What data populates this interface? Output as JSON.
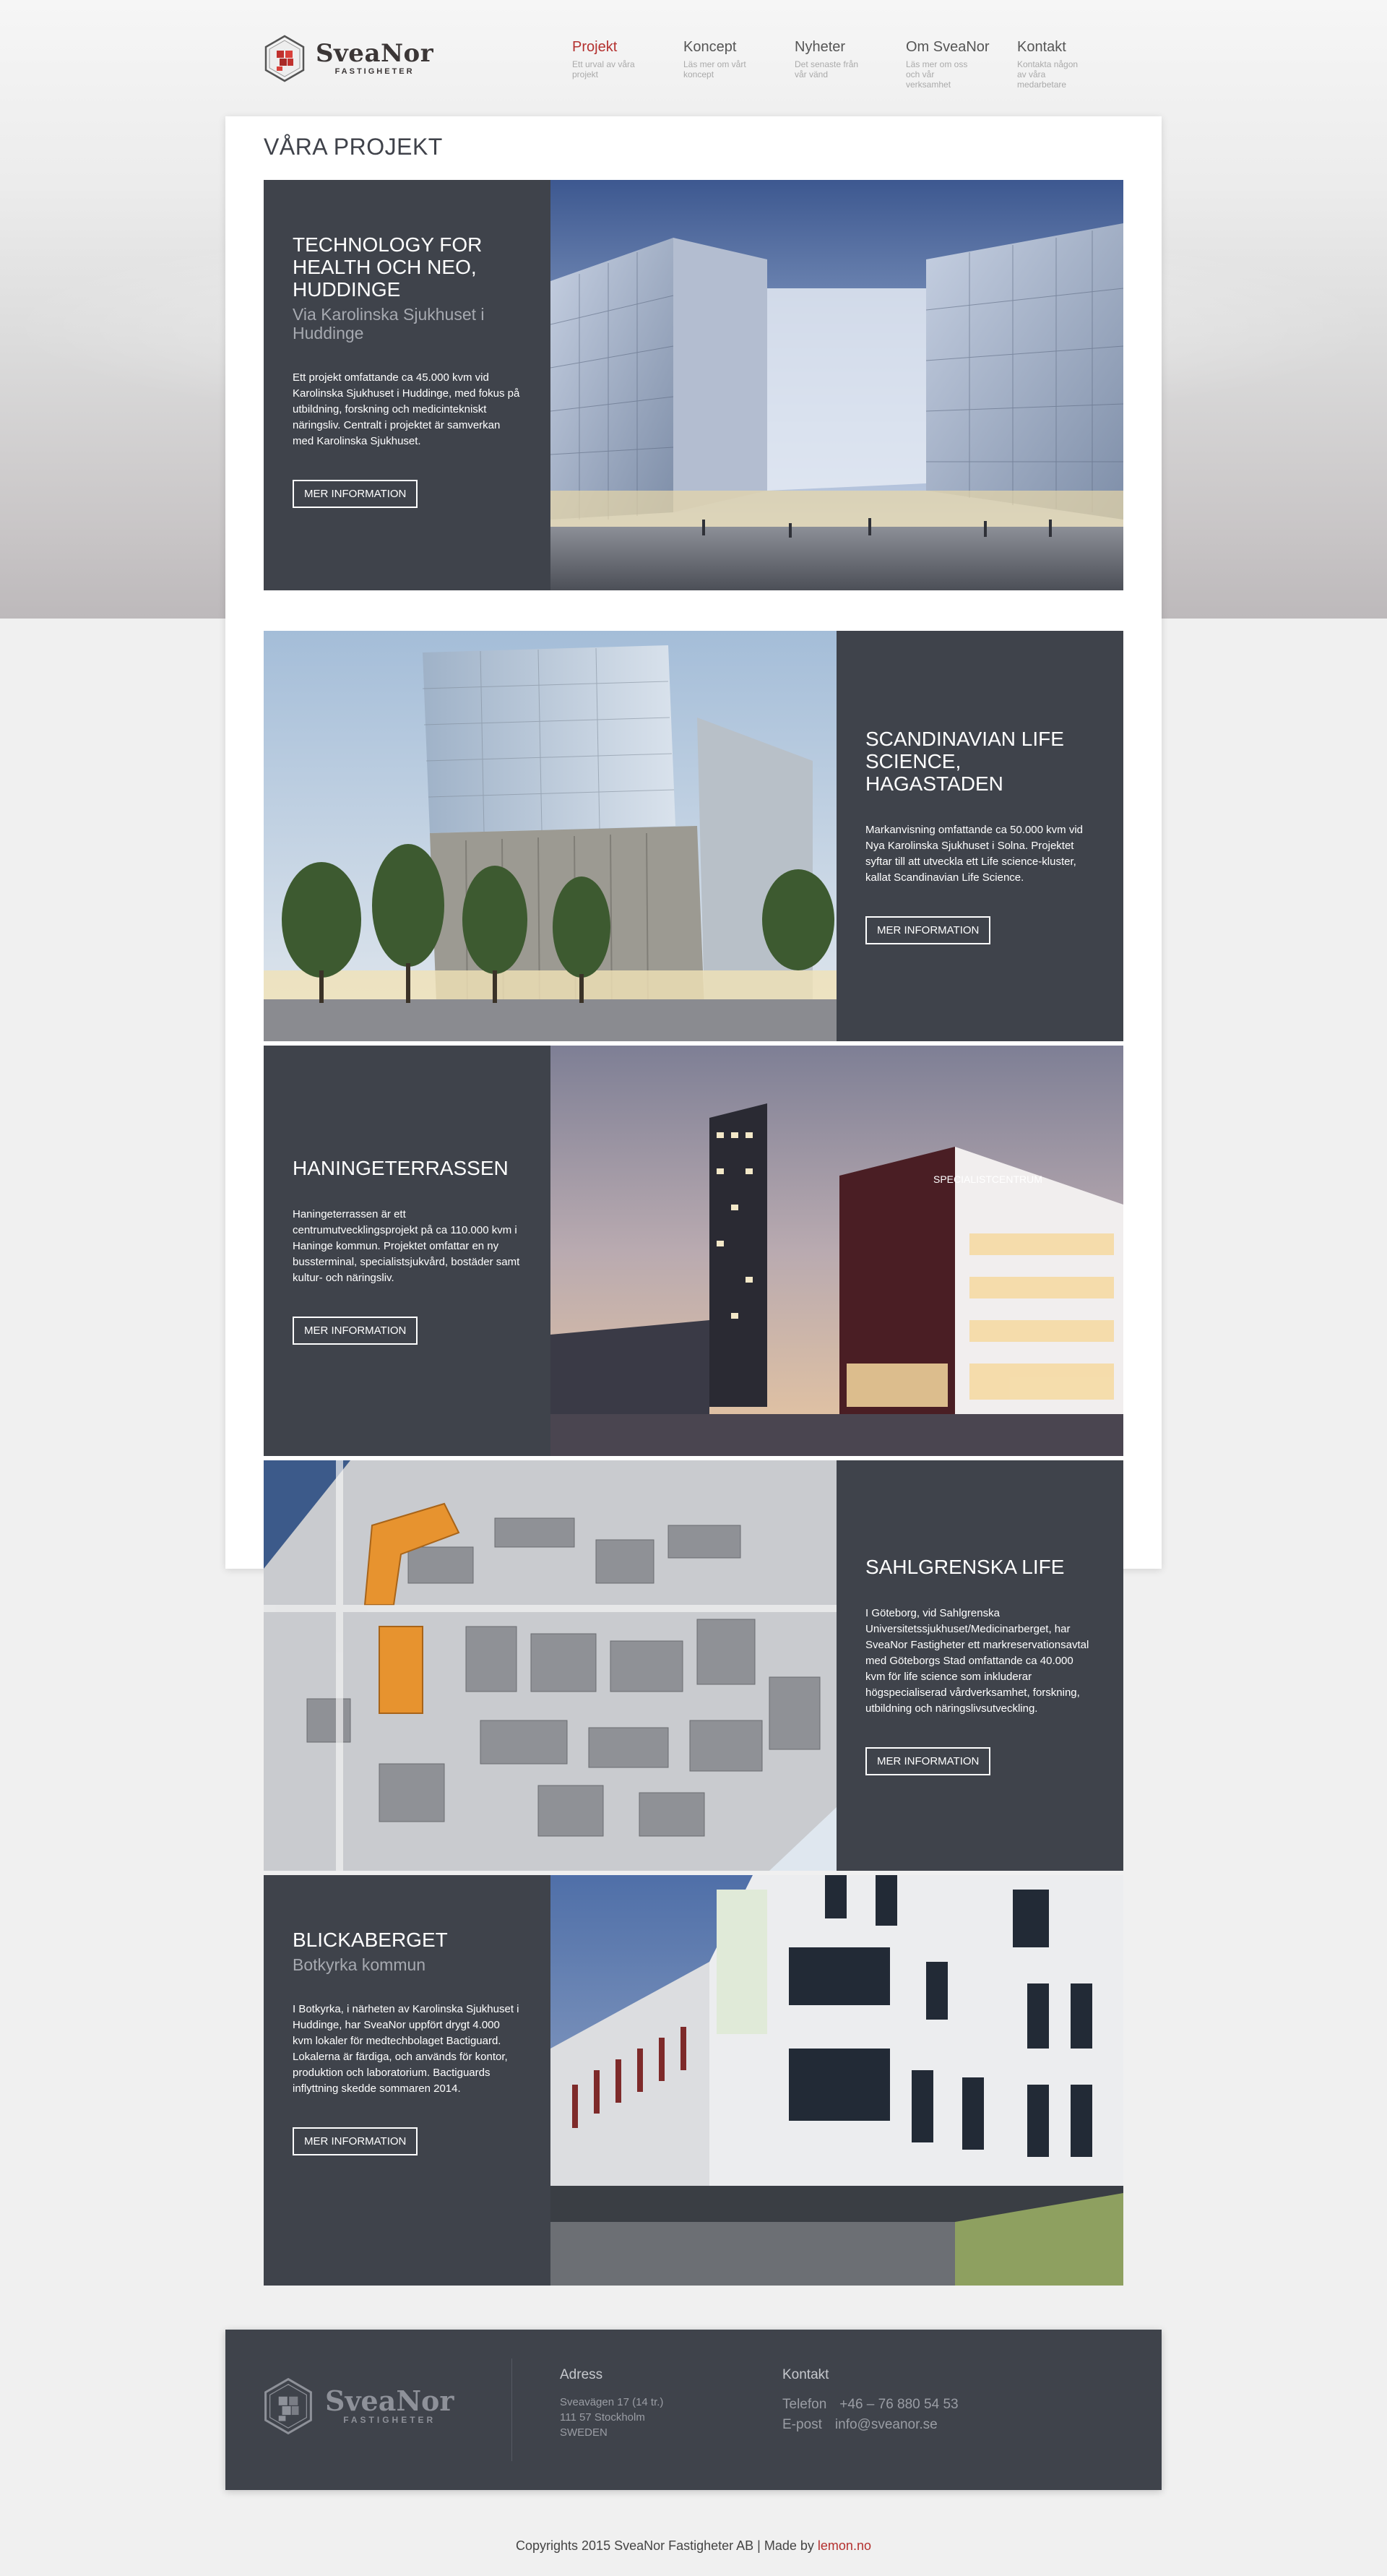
{
  "brand": {
    "name": "SveaNor",
    "sub": "FASTIGHETER",
    "accent": "#b4312f",
    "dark_panel": "#3f434b"
  },
  "nav": [
    {
      "title": "Projekt",
      "desc": "Ett urval av våra projekt",
      "active": true
    },
    {
      "title": "Koncept",
      "desc": "Läs mer om vårt koncept",
      "active": false
    },
    {
      "title": "Nyheter",
      "desc": "Det senaste från vår vänd",
      "active": false
    },
    {
      "title": "Om SveaNor",
      "desc": "Läs mer om oss och vår verksamhet",
      "active": false
    },
    {
      "title": "Kontakt",
      "desc": "Kontakta någon av våra medarbetare",
      "active": false
    }
  ],
  "page_title": "VÅRA PROJEKT",
  "projects": [
    {
      "title": "TECHNOLOGY FOR HEALTH OCH NEO, HUDDINGE",
      "subtitle": "Via Karolinska Sjukhuset i Huddinge",
      "desc": "Ett projekt omfattande ca 45.000 kvm vid Karolinska Sjukhuset i Huddinge, med fokus på utbildning, forskning och medicintekniskt näringsliv. Centralt i projektet är samverkan med Karolinska Sjukhuset.",
      "button": "MER INFORMATION",
      "image": "glass-building-illustration"
    },
    {
      "title": "SCANDINAVIAN LIFE SCIENCE, HAGASTADEN",
      "desc": "Markanvisning omfattande ca 50.000 kvm vid Nya Karolinska Sjukhuset i Solna. Projektet syftar till att utveckla ett Life science-kluster, kallat Scandinavian Life Science.",
      "button": "MER INFORMATION",
      "image": "tower-with-trees-illustration"
    },
    {
      "title": "HANINGETERRASSEN",
      "desc": "Haningeterrassen är ett centrumutvecklingsprojekt på ca 110.000 kvm i Haninge kommun. Projektet omfattar en ny bussterminal, specialistsjukvård, bostäder samt kultur- och näringsliv.",
      "button": "MER INFORMATION",
      "image": "specialistcentrum-illustration",
      "sign": "SPECIALISTCENTRUM"
    },
    {
      "title": "SAHLGRENSKA LIFE",
      "desc": "I Göteborg, vid Sahlgrenska Universitetssjukhuset/Medicinarberget, har SveaNor Fastigheter ett markreservationsavtal med Göteborgs Stad omfattande ca 40.000 kvm för life science som inkluderar högspecialiserad vårdverksamhet, forskning, utbildning och näringslivsutveckling.",
      "button": "MER INFORMATION",
      "image": "city-model-aerial"
    },
    {
      "title": "BLICKABERGET",
      "subtitle": "Botkyrka kommun",
      "desc": "I Botkyrka, i närheten av Karolinska Sjukhuset i Huddinge, har SveaNor uppfört drygt 4.000 kvm lokaler för medtechbolaget Bactiguard. Lokalerna är färdiga, och används för kontor, produktion och laboratorium. Bactiguards inflyttning skedde sommaren 2014.",
      "button": "MER INFORMATION",
      "image": "white-office-building-photo"
    }
  ],
  "footer": {
    "address_title": "Adress",
    "address_lines": [
      "Sveavägen 17 (14 tr.)",
      "111 57 Stockholm",
      "SWEDEN"
    ],
    "contact_title": "Kontakt",
    "phone_label": "Telefon",
    "phone": "+46 – 76 880 54 53",
    "email_label": "E-post",
    "email": "info@sveanor.se"
  },
  "copyright": {
    "text": "Copyrights 2015 SveaNor Fastigheter AB | Made by",
    "link": "lemon.no"
  }
}
